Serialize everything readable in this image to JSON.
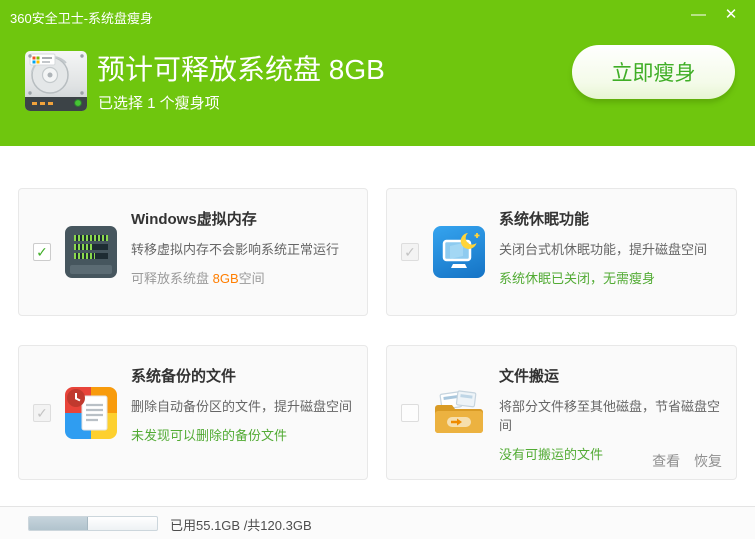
{
  "window": {
    "title": "360安全卫士-系统盘瘦身",
    "minimize_glyph": "—",
    "close_glyph": "✕"
  },
  "header": {
    "title": "预计可释放系统盘 8GB",
    "subtitle": "已选择 1 个瘦身项",
    "action_button": "立即瘦身"
  },
  "glyphs": {
    "check": "✓"
  },
  "cards": [
    {
      "id": "windows-virtual-memory",
      "title": "Windows虚拟内存",
      "desc": "转移虚拟内存不会影响系统正常运行",
      "status_prefix": "可释放系统盘 ",
      "status_highlight": "8GB",
      "status_suffix": "空间",
      "checkbox_state": "checked",
      "icon": "ram-icon"
    },
    {
      "id": "system-hibernate",
      "title": "系统休眠功能",
      "desc": "关闭台式机休眠功能，提升磁盘空间",
      "status": "系统休眠已关闭，无需瘦身",
      "checkbox_state": "checked-disabled",
      "icon": "hibernate-icon"
    },
    {
      "id": "system-backup-files",
      "title": "系统备份的文件",
      "desc": "删除自动备份区的文件，提升磁盘空间",
      "status": "未发现可以删除的备份文件",
      "checkbox_state": "checked-disabled",
      "icon": "backup-icon"
    },
    {
      "id": "file-move",
      "title": "文件搬运",
      "desc": "将部分文件移至其他磁盘，节省磁盘空间",
      "status": "没有可搬运的文件",
      "checkbox_state": "unchecked",
      "icon": "folder-move-icon",
      "links": [
        {
          "label": "查看"
        },
        {
          "label": "恢复"
        }
      ]
    }
  ],
  "footer": {
    "usage_text": "已用55.1GB /共120.3GB",
    "used_gb": 55.1,
    "total_gb": 120.3,
    "used_percent": 45.8,
    "fill_style": "width:45.8%"
  },
  "colors": {
    "brand_green": "#6fc60e",
    "button_text_green": "#3fae26",
    "status_green": "#52ab34",
    "highlight_orange": "#ff7e00"
  }
}
